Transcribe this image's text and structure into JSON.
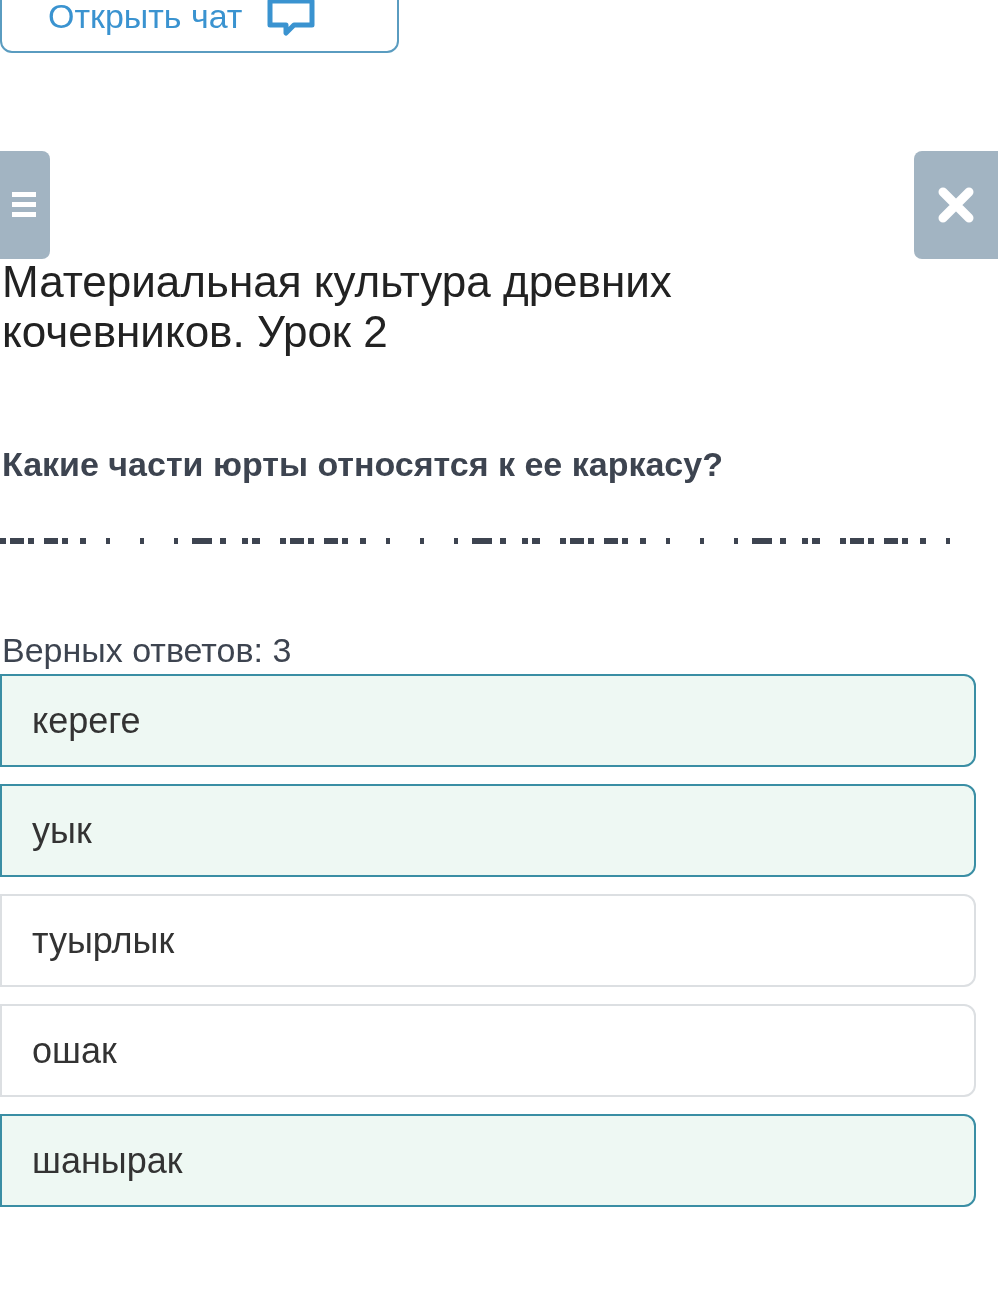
{
  "chat_button": {
    "label": "Открыть чат"
  },
  "title": "Материальная культура древних кочевников. Урок 2",
  "question": "Какие части юрты относятся к ее каркасу?",
  "answer_count": "Верных ответов: 3",
  "options": [
    {
      "label": "кереге",
      "selected": true
    },
    {
      "label": "уык",
      "selected": true
    },
    {
      "label": "туырлык",
      "selected": false
    },
    {
      "label": "ошак",
      "selected": false
    },
    {
      "label": "шанырак",
      "selected": true
    }
  ]
}
